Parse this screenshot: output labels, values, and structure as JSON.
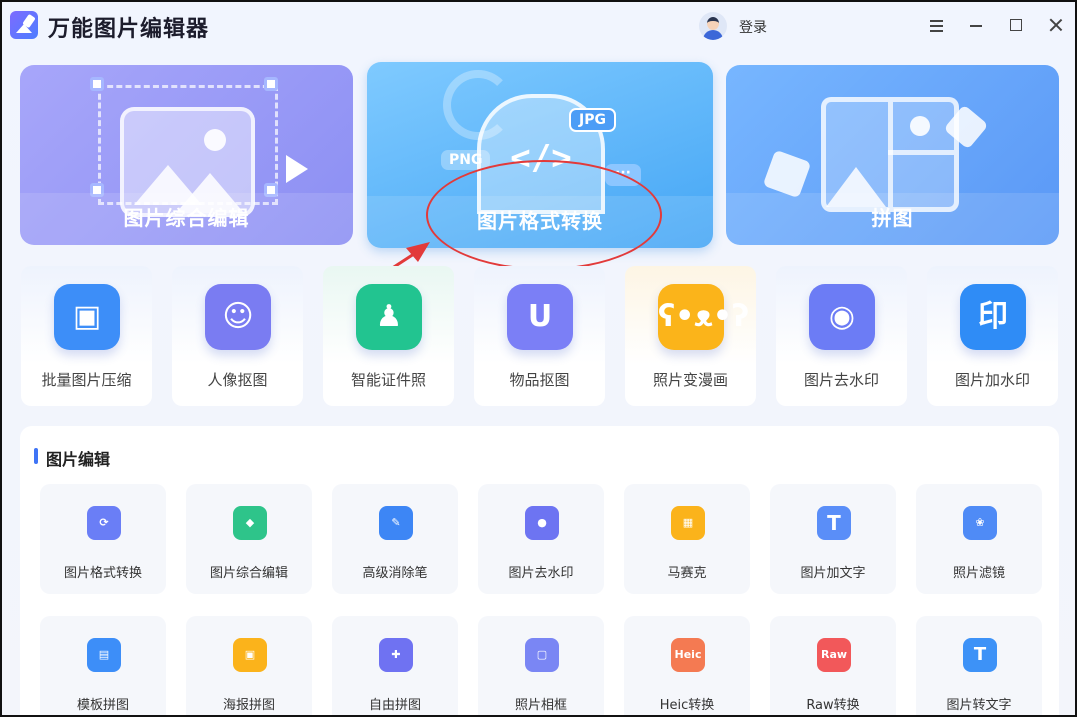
{
  "app": {
    "title": "万能图片编辑器",
    "login_label": "登录"
  },
  "feature_cards": [
    {
      "label": "图片综合编辑"
    },
    {
      "label": "图片格式转换",
      "badges": [
        "JPG",
        "PNG"
      ],
      "code": "</>"
    },
    {
      "label": "拼图"
    }
  ],
  "tools": [
    {
      "label": "批量图片压缩",
      "color": "#3d8ef8"
    },
    {
      "label": "人像抠图",
      "color": "#7a7cf2"
    },
    {
      "label": "智能证件照",
      "color": "#22c490"
    },
    {
      "label": "物品抠图",
      "color": "#7b7ff6"
    },
    {
      "label": "照片变漫画",
      "color": "#fbb41a"
    },
    {
      "label": "图片去水印",
      "color": "#6c7cf5"
    },
    {
      "label": "图片加水印",
      "color": "#2f8cf6",
      "glyph": "印"
    }
  ],
  "edit_section": {
    "title": "图片编辑",
    "items": [
      {
        "label": "图片格式转换",
        "color": "#6a7ef6"
      },
      {
        "label": "图片综合编辑",
        "color": "#2ec48a"
      },
      {
        "label": "高级消除笔",
        "color": "#3d86f5"
      },
      {
        "label": "图片去水印",
        "color": "#6d74f2"
      },
      {
        "label": "马赛克",
        "color": "#fbb31b"
      },
      {
        "label": "图片加文字",
        "color": "#5a8ef8"
      },
      {
        "label": "照片滤镜",
        "color": "#4f8bf6"
      },
      {
        "label": "模板拼图",
        "color": "#3d8ef8"
      },
      {
        "label": "海报拼图",
        "color": "#fbb31b"
      },
      {
        "label": "自由拼图",
        "color": "#6f72f2"
      },
      {
        "label": "照片相框",
        "color": "#7a86f4"
      },
      {
        "label": "Heic转换",
        "color": "#f47a52",
        "glyph": "Heic"
      },
      {
        "label": "Raw转换",
        "color": "#f2585a",
        "glyph": "Raw"
      },
      {
        "label": "图片转文字",
        "color": "#3d92f7"
      }
    ]
  },
  "annotation": {
    "color": "#e23a3a"
  }
}
